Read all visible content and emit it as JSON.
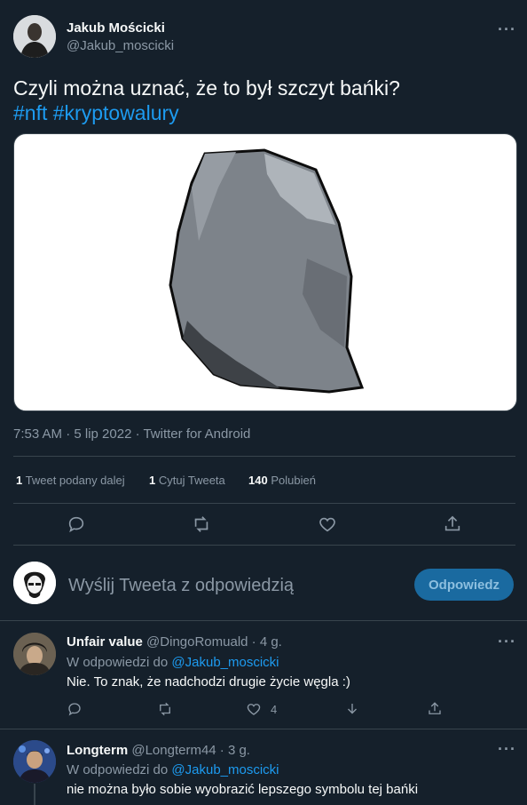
{
  "tweet": {
    "author_name": "Jakub Mościcki",
    "author_handle": "@Jakub_moscicki",
    "text_line1": "Czyli można uznać, że to był szczyt bańki?",
    "hashtag1": "#nft",
    "hashtag2": "#kryptowalury",
    "timestamp": "7:53 AM · 5 lip 2022 · Twitter for Android",
    "more_label": "···"
  },
  "stats": {
    "retweets_count": "1",
    "retweets_label": "Tweet podany dalej",
    "quotes_count": "1",
    "quotes_label": "Cytuj Tweeta",
    "likes_count": "140",
    "likes_label": "Polubień"
  },
  "composer": {
    "placeholder": "Wyślij Tweeta z odpowiedzią",
    "reply_button": "Odpowiedz"
  },
  "replies": [
    {
      "name": "Unfair value",
      "handle_time": "@DingoRomuald · 4 g.",
      "reply_to_prefix": "W odpowiedzi do",
      "reply_to_handle": "@Jakub_moscicki",
      "text": "Nie. To znak, że nadchodzi drugie życie węgla :)",
      "like_count": "4"
    },
    {
      "name": "Longterm",
      "handle_time": "@Longterm44 · 3 g.",
      "reply_to_prefix": "W odpowiedzi do",
      "reply_to_handle": "@Jakub_moscicki",
      "text": "nie można było sobie wyobrazić lepszego symbolu tej bańki"
    }
  ],
  "colors": {
    "background": "#15202b",
    "accent": "#1d9bf0",
    "muted": "#8b98a5",
    "divider": "#38444d"
  }
}
